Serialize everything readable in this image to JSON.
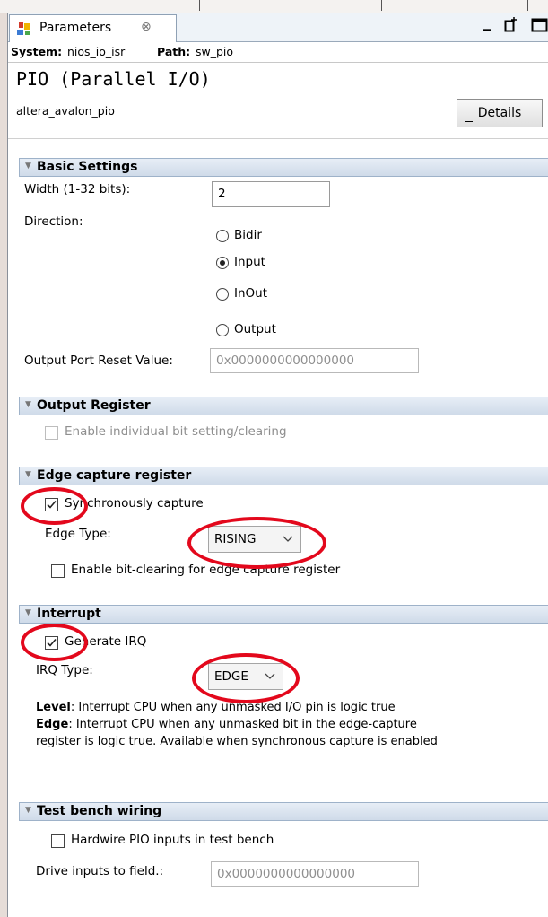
{
  "window": {
    "tab_label": "Parameters",
    "tab_close_glyph": "⊗",
    "minimize_glyph": "_"
  },
  "path_bar": {
    "system_label": "System:",
    "system_value": "nios_io_isr",
    "path_label": "Path:",
    "path_value": "sw_pio"
  },
  "header": {
    "title": "PIO (Parallel I/O)",
    "subtitle": "altera_avalon_pio",
    "details_button": "Details"
  },
  "basic_settings": {
    "title": "Basic Settings",
    "width_label": "Width (1-32 bits):",
    "width_value": "2",
    "direction_label": "Direction:",
    "direction_options": [
      "Bidir",
      "Input",
      "InOut",
      "Output"
    ],
    "direction_selected": "Input",
    "reset_label": "Output Port Reset Value:",
    "reset_value": "0x0000000000000000"
  },
  "output_register": {
    "title": "Output Register",
    "enable_bit_label": "Enable individual bit setting/clearing",
    "enable_bit_checked": false
  },
  "edge_capture": {
    "title": "Edge capture register",
    "sync_label": "Synchronously capture",
    "sync_checked": true,
    "edge_type_label": "Edge Type:",
    "edge_type_value": "RISING",
    "bit_clear_label": "Enable bit-clearing for edge capture register",
    "bit_clear_checked": false
  },
  "interrupt": {
    "title": "Interrupt",
    "irq_label": "Generate IRQ",
    "irq_checked": true,
    "irq_type_label": "IRQ Type:",
    "irq_type_value": "EDGE",
    "level_term": "Level",
    "level_text": ": Interrupt CPU when any unmasked I/O pin is logic true",
    "edge_term": "Edge",
    "edge_text_1": ": Interrupt CPU when any unmasked bit in the edge-capture",
    "edge_text_2": "register is logic true. Available when synchronous capture is enabled"
  },
  "test_bench": {
    "title": "Test bench wiring",
    "hardwire_label": "Hardwire PIO inputs in test bench",
    "hardwire_checked": false,
    "drive_label": "Drive inputs to field.:",
    "drive_value": "0x0000000000000000"
  },
  "colors": {
    "annotation_circle": "#e3081c",
    "section_bar": "#d5e0ec",
    "tab_bar": "#eef3f8"
  }
}
